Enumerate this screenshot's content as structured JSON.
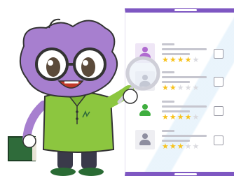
{
  "scene": {
    "description_icon": "mascot-with-magnifier"
  },
  "phone": {
    "accent": "#7e57c2",
    "rows": [
      {
        "avatar_color": "#b06bd0",
        "avatar_bg": "#efe6f6",
        "rating": 4,
        "max_rating": 5
      },
      {
        "avatar_color": "#8e8ea0",
        "avatar_bg": "#eeeef2",
        "rating": 2,
        "max_rating": 5
      },
      {
        "avatar_color": "#3fae3f",
        "avatar_bg": "#ffffff",
        "rating": 4,
        "max_rating": 5
      },
      {
        "avatar_color": "#8e8ea0",
        "avatar_bg": "#eeeef2",
        "rating": 3,
        "max_rating": 5
      }
    ]
  },
  "colors": {
    "mascot_body": "#a77fcf",
    "mascot_shirt": "#8cc63f",
    "mascot_pants": "#3a3a4a",
    "book": "#2f6b3a",
    "star": "#f7c21c"
  }
}
